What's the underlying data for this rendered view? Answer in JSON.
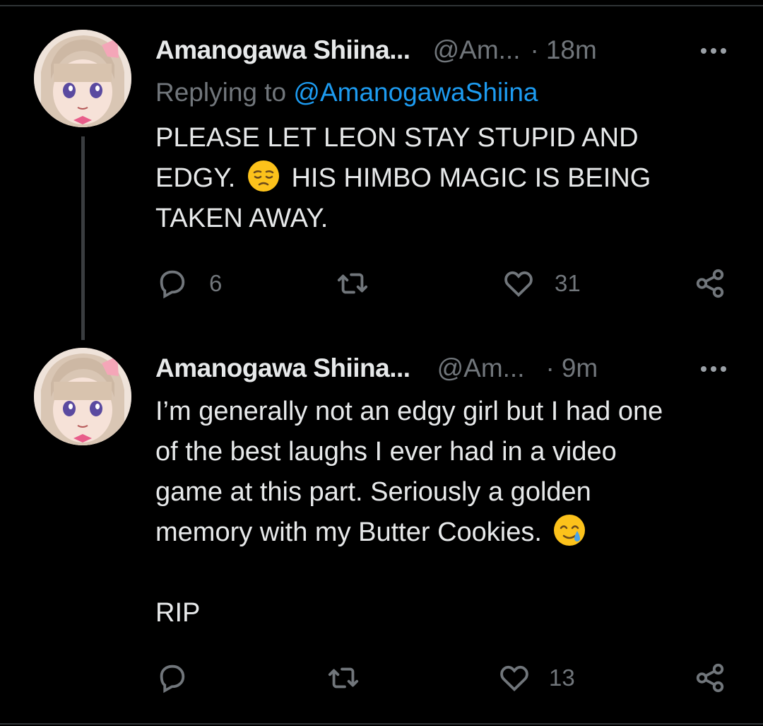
{
  "tweets": [
    {
      "name": "Amanogawa Shiina...",
      "handle": "@Am...",
      "separator": "·",
      "time": "18m",
      "replying_prefix": "Replying to ",
      "replying_to": "@AmanogawaShiina",
      "text_line1": "PLEASE LET LEON STAY STUPID AND",
      "text_line2a": "EDGY.",
      "text_line2b": "HIS HIMBO MAGIC IS BEING",
      "text_line3": "TAKEN AWAY.",
      "reply_count": "6",
      "retweet_count": "",
      "like_count": "31",
      "emoji": "pensive-face"
    },
    {
      "name": "Amanogawa Shiina...",
      "handle": "@Am...",
      "separator": "·",
      "time": "9m",
      "text_line1": "I’m generally not an edgy girl but I had one",
      "text_line2": "of the best laughs I ever had in a video",
      "text_line3": "game at this part. Seriously a golden",
      "text_line4": "memory with my Butter Cookies.",
      "text_line5": "RIP",
      "reply_count": "",
      "retweet_count": "",
      "like_count": "13",
      "emoji": "smiling-face-with-tear"
    }
  ],
  "colors": {
    "background": "#000000",
    "text": "#e7e9ea",
    "muted": "#71767b",
    "link": "#1d9bf0",
    "thread_line": "#3a3d40"
  }
}
